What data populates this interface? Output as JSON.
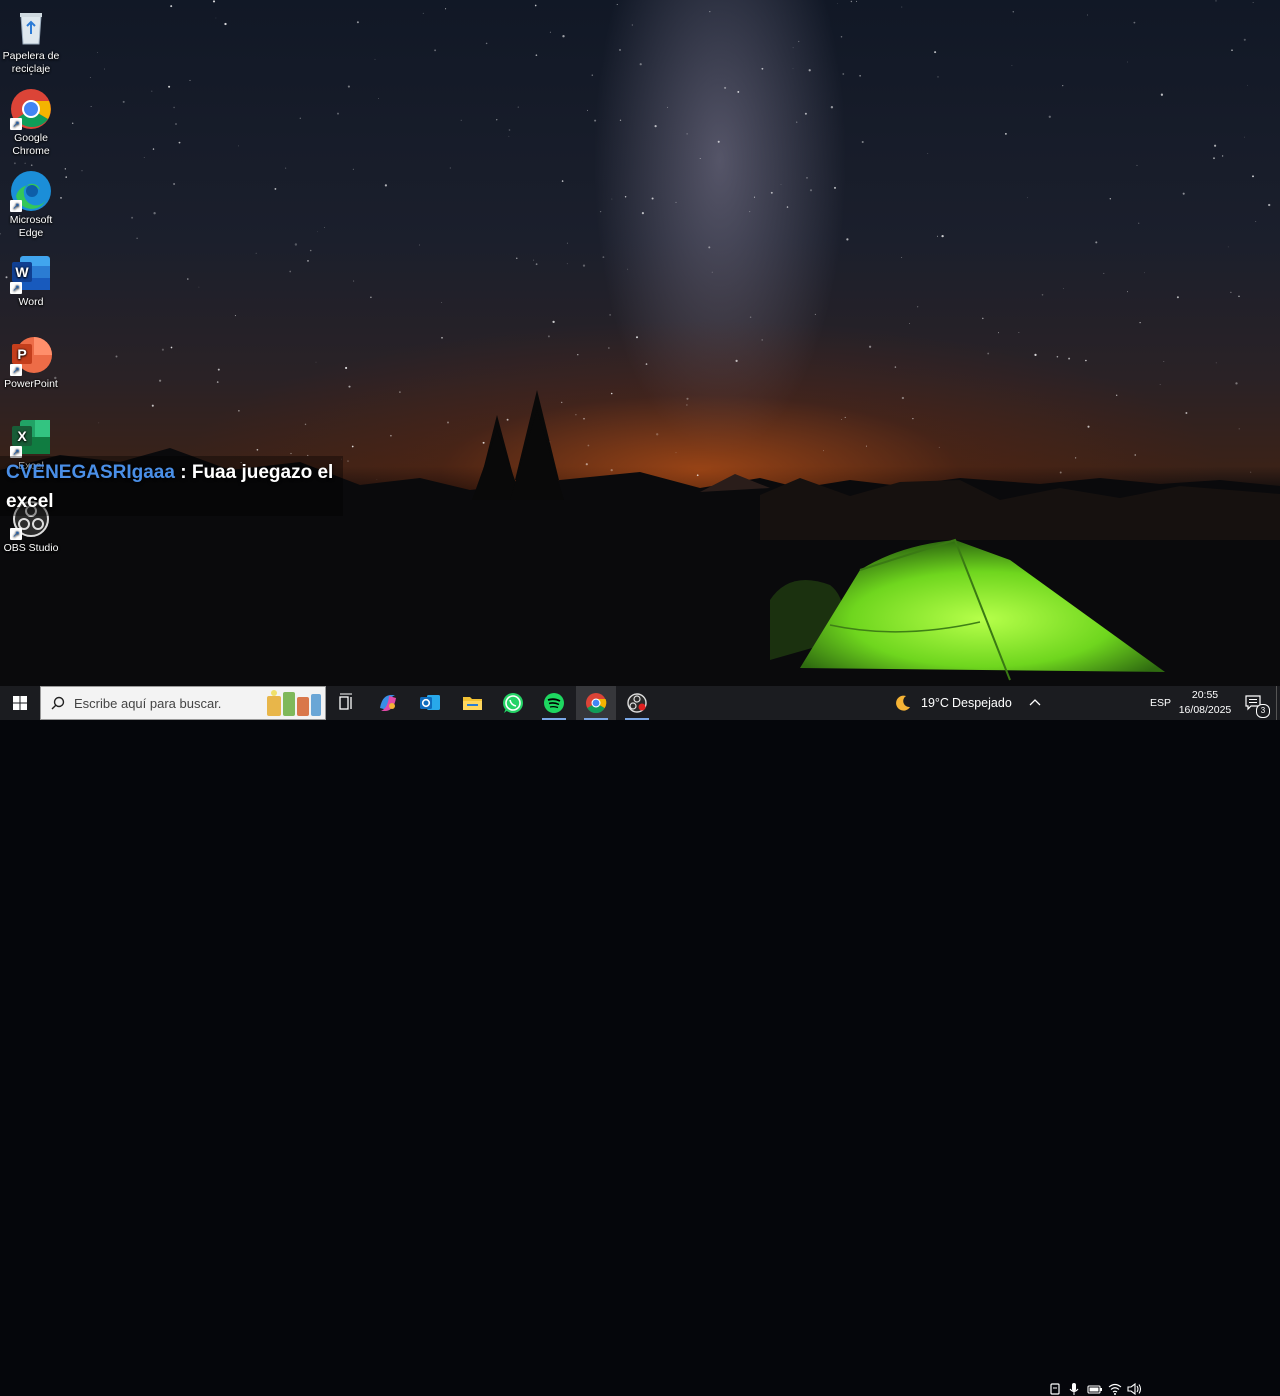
{
  "desktop": {
    "icons": [
      {
        "name": "recycle-bin",
        "label": "Papelera de reciclaje"
      },
      {
        "name": "google-chrome",
        "label": "Google Chrome"
      },
      {
        "name": "microsoft-edge",
        "label": "Microsoft Edge"
      },
      {
        "name": "word",
        "label": "Word"
      },
      {
        "name": "powerpoint",
        "label": "PowerPoint"
      },
      {
        "name": "excel",
        "label": "Excel"
      },
      {
        "name": "obs-studio",
        "label": "OBS Studio"
      }
    ]
  },
  "chat_overlay": {
    "username": "CVENEGASRIgaaa",
    "separator": " : ",
    "message": "Fuaa juegazo el excel"
  },
  "taskbar": {
    "search_placeholder": "Escribe aquí para buscar.",
    "apps": [
      {
        "name": "task-view-icon",
        "active": false
      },
      {
        "name": "copilot-icon",
        "active": false
      },
      {
        "name": "outlook-icon",
        "active": false
      },
      {
        "name": "file-explorer-icon",
        "active": false
      },
      {
        "name": "whatsapp-icon",
        "active": false
      },
      {
        "name": "spotify-icon",
        "active": true
      },
      {
        "name": "chrome-icon",
        "active": true
      },
      {
        "name": "obs-icon",
        "active": true
      }
    ],
    "weather": {
      "temp": "19°C",
      "condition": "Despejado"
    },
    "language": "ESP",
    "time": "20:55",
    "date": "16/08/2025",
    "notification_count": "3"
  },
  "colors": {
    "taskbar_bg": "#1b1c20",
    "chat_username": "#4a8fe7",
    "active_indicator": "#7aa7e6",
    "tent_green": "#7ee02a"
  }
}
